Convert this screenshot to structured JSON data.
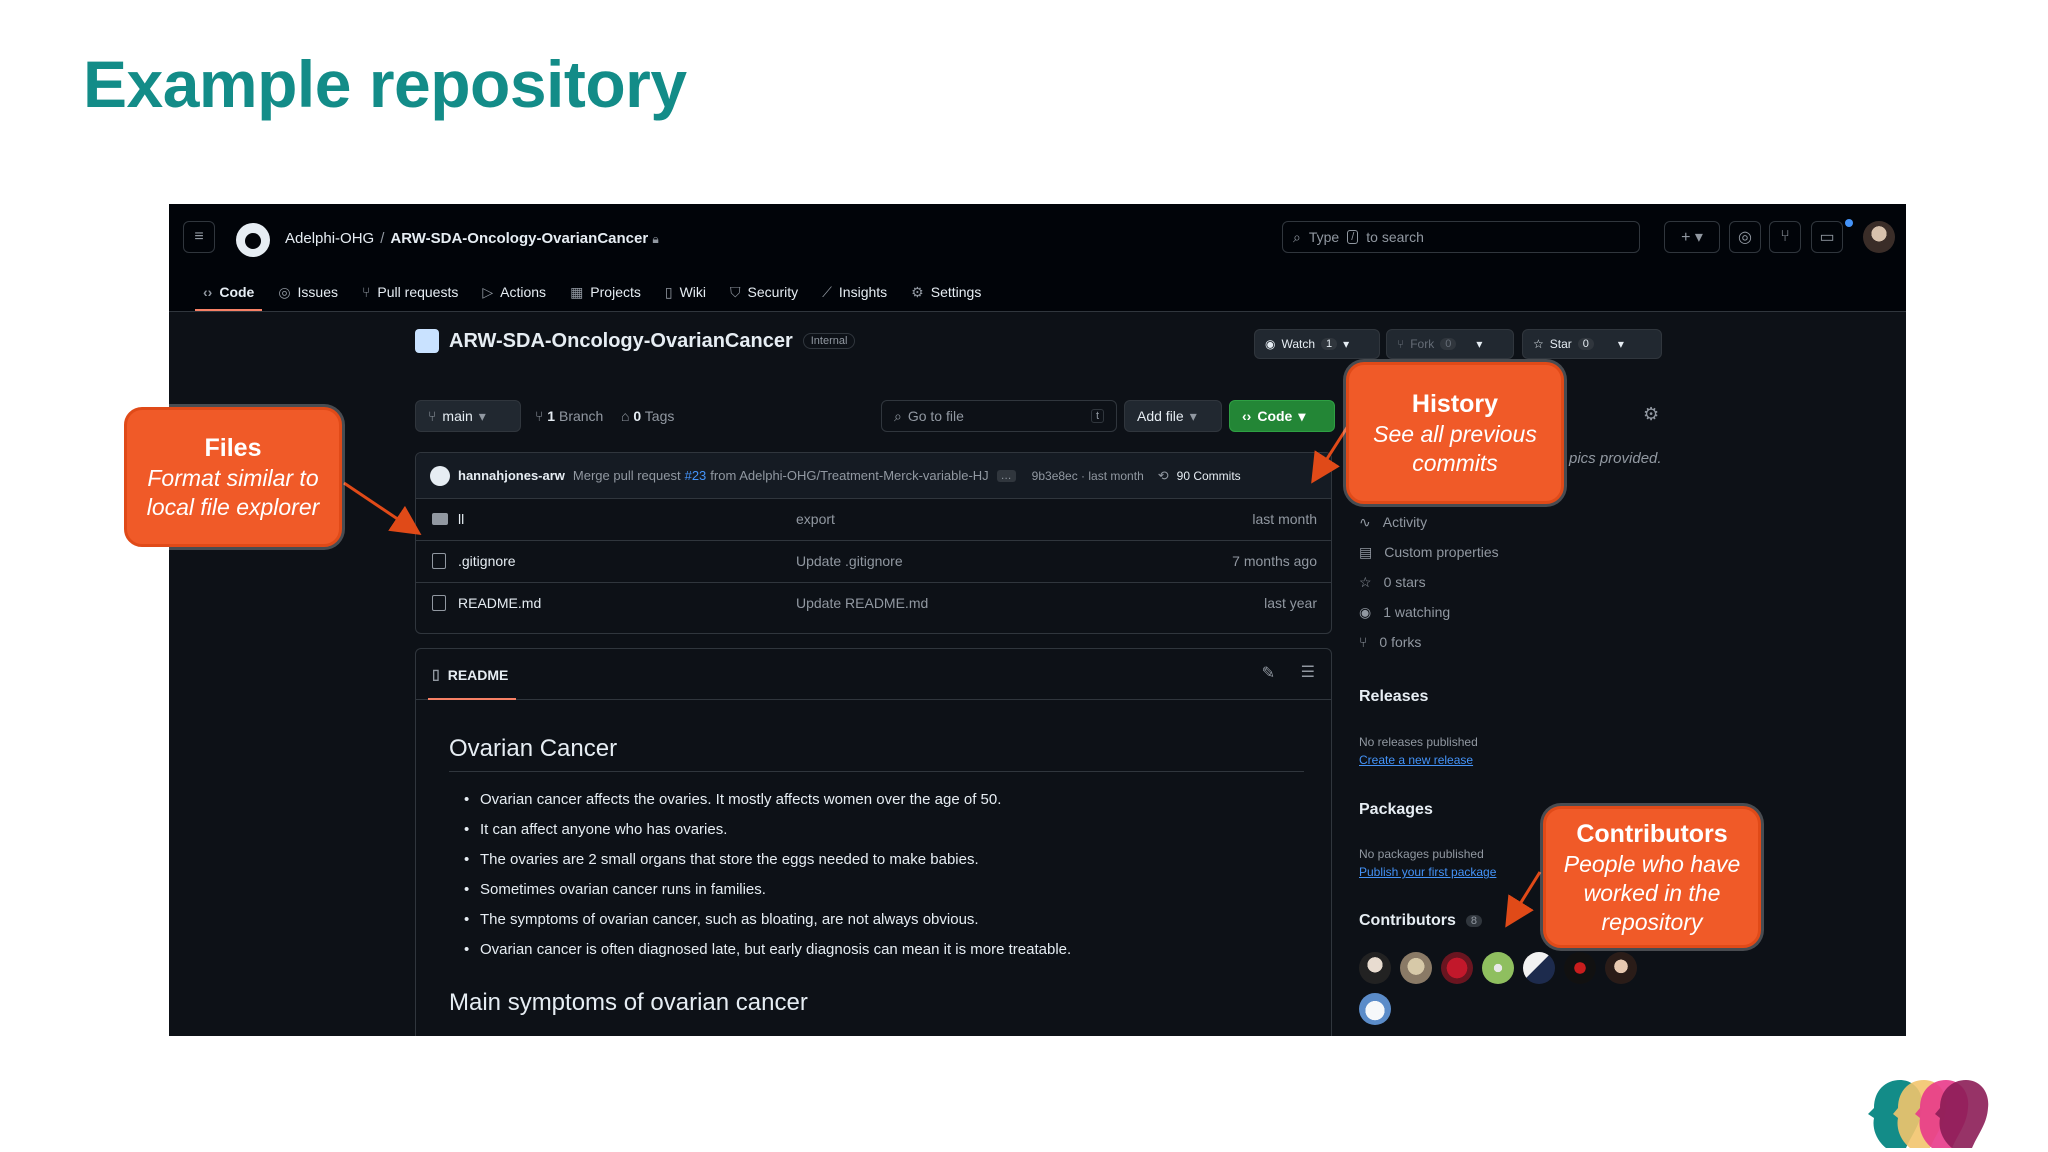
{
  "slide": {
    "title": "Example repository"
  },
  "header": {
    "org": "Adelphi-OHG",
    "separator": "/",
    "repo": "ARW-SDA-Oncology-OvarianCancer",
    "search_prefix": "Type",
    "search_key": "/",
    "search_suffix": "to search"
  },
  "tabs": [
    "Code",
    "Issues",
    "Pull requests",
    "Actions",
    "Projects",
    "Wiki",
    "Security",
    "Insights",
    "Settings"
  ],
  "repo_header": {
    "name": "ARW-SDA-Oncology-OvarianCancer",
    "visibility": "Internal",
    "watch_label": "Watch",
    "watch_count": "1",
    "fork_label": "Fork",
    "fork_count": "0",
    "star_label": "Star",
    "star_count": "0"
  },
  "toolbar": {
    "branch": "main",
    "branch_count": "1",
    "branch_label": "Branch",
    "tag_count": "0",
    "tag_label": "Tags",
    "goto_placeholder": "Go to file",
    "goto_key": "t",
    "add_file": "Add file",
    "code": "Code"
  },
  "commit": {
    "author": "hannahjones-arw",
    "message_prefix": "Merge pull request",
    "pr": "#23",
    "message_suffix": "from Adelphi-OHG/Treatment-Merck-variable-HJ",
    "ellipsis": "…",
    "sha_time": "9b3e8ec · last month",
    "commits": "90 Commits"
  },
  "files": [
    {
      "name": "ll",
      "message": "export",
      "time": "last month",
      "type": "folder"
    },
    {
      "name": ".gitignore",
      "message": "Update .gitignore",
      "time": "7 months ago",
      "type": "file"
    },
    {
      "name": "README.md",
      "message": "Update README.md",
      "time": "last year",
      "type": "file"
    }
  ],
  "readme": {
    "tab": "README",
    "heading1": "Ovarian Cancer",
    "bullets": [
      "Ovarian cancer affects the ovaries. It mostly affects women over the age of 50.",
      "It can affect anyone who has ovaries.",
      "The ovaries are 2 small organs that store the eggs needed to make babies.",
      "Sometimes ovarian cancer runs in families.",
      "The symptoms of ovarian cancer, such as bloating, are not always obvious.",
      "Ovarian cancer is often diagnosed late, but early diagnosis can mean it is more treatable."
    ],
    "heading2": "Main symptoms of ovarian cancer"
  },
  "sidebar": {
    "about_fragment": "pics provided.",
    "meta": [
      "Activity",
      "Custom properties",
      "0 stars",
      "1 watching",
      "0 forks"
    ],
    "releases_title": "Releases",
    "releases_empty": "No releases published",
    "releases_link": "Create a new release",
    "packages_title": "Packages",
    "packages_empty": "No packages published",
    "packages_link": "Publish your first package",
    "contributors_title": "Contributors",
    "contributors_count": "8"
  },
  "callouts": {
    "files_title": "Files",
    "files_sub": "Format similar to local file explorer",
    "history_title": "History",
    "history_sub": "See all previous commits",
    "contrib_title": "Contributors",
    "contrib_sub": "People who have worked in the repository"
  },
  "colors": {
    "title_teal": "#138c88",
    "callout_orange": "#f05a28",
    "github_dark_bg": "#0d1117",
    "code_button_green": "#238636",
    "link_blue": "#4493f8"
  }
}
